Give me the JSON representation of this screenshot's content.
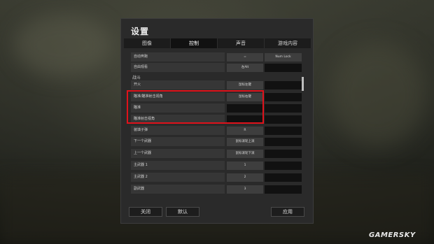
{
  "dialog": {
    "title": "设置",
    "tabs": [
      {
        "label": "图像",
        "active": false
      },
      {
        "label": "控制",
        "active": true
      },
      {
        "label": "声音",
        "active": false
      },
      {
        "label": "游戏内容",
        "active": false
      }
    ],
    "rows_top": [
      {
        "label": "自动奔跑",
        "key1": "=",
        "key2": "Num Lock"
      },
      {
        "label": "自由观看",
        "key1": "左Alt",
        "key2": ""
      }
    ],
    "section_combat": "战斗",
    "rows_combat": [
      {
        "label": "开火",
        "key1": "鼠标左键",
        "key2": ""
      },
      {
        "label": "瞄准/瞄准射击视角",
        "key1": "鼠标右键",
        "key2": ""
      },
      {
        "label": "瞄准",
        "key1": "",
        "key2": ""
      },
      {
        "label": "瞄准射击视角",
        "key1": "",
        "key2": ""
      },
      {
        "label": "装填子弹",
        "key1": "R",
        "key2": ""
      },
      {
        "label": "下一个武器",
        "key1": "鼠标滚轮上滚",
        "key2": ""
      },
      {
        "label": "上一个武器",
        "key1": "鼠标滚轮下滚",
        "key2": ""
      },
      {
        "label": "主武器 1",
        "key1": "1",
        "key2": ""
      },
      {
        "label": "主武器 2",
        "key1": "2",
        "key2": ""
      },
      {
        "label": "副武器",
        "key1": "3",
        "key2": ""
      }
    ],
    "buttons": {
      "close": "关闭",
      "default": "默认",
      "apply": "应用"
    }
  },
  "watermark": "GAMERSKY",
  "colors": {
    "highlight_box": "#e0121b",
    "panel_bg": "#2a2a2a"
  }
}
